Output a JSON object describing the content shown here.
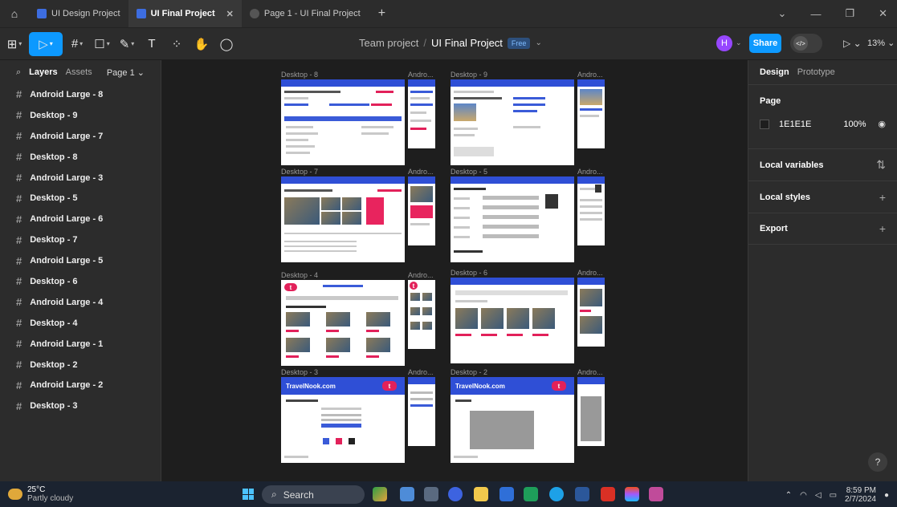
{
  "tabs": [
    {
      "label": "UI Design Project"
    },
    {
      "label": "UI Final Project"
    },
    {
      "label": "Page 1 - UI Final Project"
    }
  ],
  "breadcrumb": {
    "team": "Team project",
    "sep": "/",
    "project": "UI Final Project",
    "plan": "Free"
  },
  "toolbar": {
    "share": "Share",
    "zoom": "13%",
    "avatar": "H",
    "text_tool": "T"
  },
  "left_panel": {
    "tabs": {
      "layers": "Layers",
      "assets": "Assets"
    },
    "page": "Page 1",
    "layers": [
      "Android Large - 8",
      "Desktop - 9",
      "Android Large - 7",
      "Desktop - 8",
      "Android Large - 3",
      "Desktop - 5",
      "Android Large - 6",
      "Desktop - 7",
      "Android Large - 5",
      "Desktop - 6",
      "Android Large - 4",
      "Desktop - 4",
      "Android Large - 1",
      "Desktop - 2",
      "Android Large - 2",
      "Desktop - 3"
    ]
  },
  "right_panel": {
    "tabs": {
      "design": "Design",
      "prototype": "Prototype"
    },
    "page_title": "Page",
    "bg_hex": "1E1E1E",
    "bg_opacity": "100%",
    "sections": [
      "Local variables",
      "Local styles",
      "Export"
    ]
  },
  "canvas": {
    "frames": [
      "Desktop - 8",
      "Andro...",
      "Desktop - 9",
      "Andro...",
      "Desktop - 7",
      "Andro...",
      "Desktop - 5",
      "Andro...",
      "Desktop - 4",
      "Andro...",
      "Desktop - 6",
      "Andro...",
      "Desktop - 3",
      "Andro...",
      "Desktop - 2",
      "Andro..."
    ],
    "brand": "TravelNook.com",
    "hero_question": "What's your best stay?",
    "popular": "Most popular destinations",
    "personal_info": "Personal Information",
    "credit": "Credit card details",
    "about": "About us",
    "hotel": "Four Seasons George V Paris, France",
    "hotel_short": "Four Seasons George V Paris",
    "confirm": "Confirm reservation",
    "hotel_v": "Four Seasons Hotel George V",
    "welcome": "Welcome to TravelNook.com",
    "login": "Log in or create an account"
  },
  "taskbar": {
    "temp": "25°C",
    "weather": "Partly cloudy",
    "search": "Search",
    "time": "8:59 PM",
    "date": "2/7/2024"
  },
  "colors": {
    "accent": "#0d99ff",
    "brand_blue": "#2f4fd6",
    "brand_pink": "#e2215a"
  }
}
